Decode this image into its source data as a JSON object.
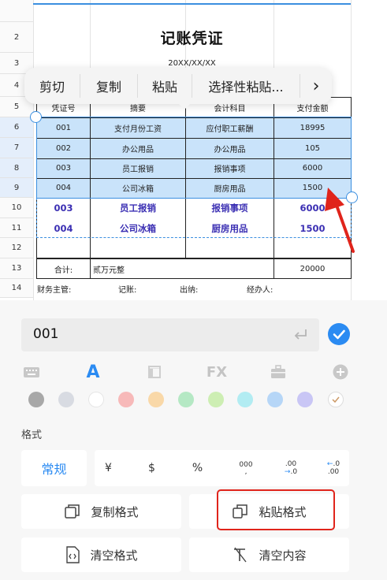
{
  "sheet": {
    "rows": [
      "",
      "2",
      "3",
      "4",
      "5",
      "6",
      "7",
      "8",
      "9",
      "10",
      "11",
      "12",
      "13",
      "14"
    ],
    "title": "记账凭证",
    "date": "20XX/XX/XX",
    "columns": [
      "凭证号",
      "摘要",
      "会计科目",
      "支付金额"
    ],
    "data_rows": [
      [
        "001",
        "支付月份工资",
        "应付职工薪酬",
        "18995"
      ],
      [
        "002",
        "办公用品",
        "办公用品",
        "105"
      ],
      [
        "003",
        "员工报销",
        "报销事项",
        "6000"
      ],
      [
        "004",
        "公司冰箱",
        "厨房用品",
        "1500"
      ]
    ],
    "pasted_rows": [
      [
        "003",
        "员工报销",
        "报销事项",
        "6000"
      ],
      [
        "004",
        "公司冰箱",
        "厨房用品",
        "1500"
      ]
    ],
    "total_label": "合计:",
    "total_words": "贰万元整",
    "total_value": "20000",
    "row14": [
      "财务主管:",
      "记账:",
      "出纳:",
      "经办人:"
    ],
    "accent_color": "#3b8fe0",
    "selection_fill": "#c9e3fa",
    "annotation_color": "#e0241b"
  },
  "context_menu": {
    "items": [
      "剪切",
      "复制",
      "粘贴",
      "选择性粘贴..."
    ],
    "more": "›"
  },
  "panel": {
    "cell_input_value": "001",
    "toolbar_icons": [
      "keyboard-icon",
      "text-style-icon",
      "cell-style-icon",
      "function-icon",
      "toolbox-icon",
      "add-icon"
    ],
    "text_style_label": "A",
    "function_label": "FX",
    "swatch_colors": [
      "#a8a8a8",
      "#d8dbe2",
      "#ffffff",
      "#f7b9b9",
      "#f9d8a8",
      "#b5e8c4",
      "#cdeeb3",
      "#b2ecf2",
      "#b6d6f7",
      "#c9c6f5"
    ],
    "format_label": "格式",
    "normal_label": "常规",
    "number_formats": [
      "¥",
      "$",
      "%",
      "000",
      ".00",
      ".0"
    ],
    "copy_format": "复制格式",
    "paste_format": "粘贴格式",
    "clear_format": "清空格式",
    "clear_content": "清空内容",
    "brand_color": "#2b8bf2"
  }
}
